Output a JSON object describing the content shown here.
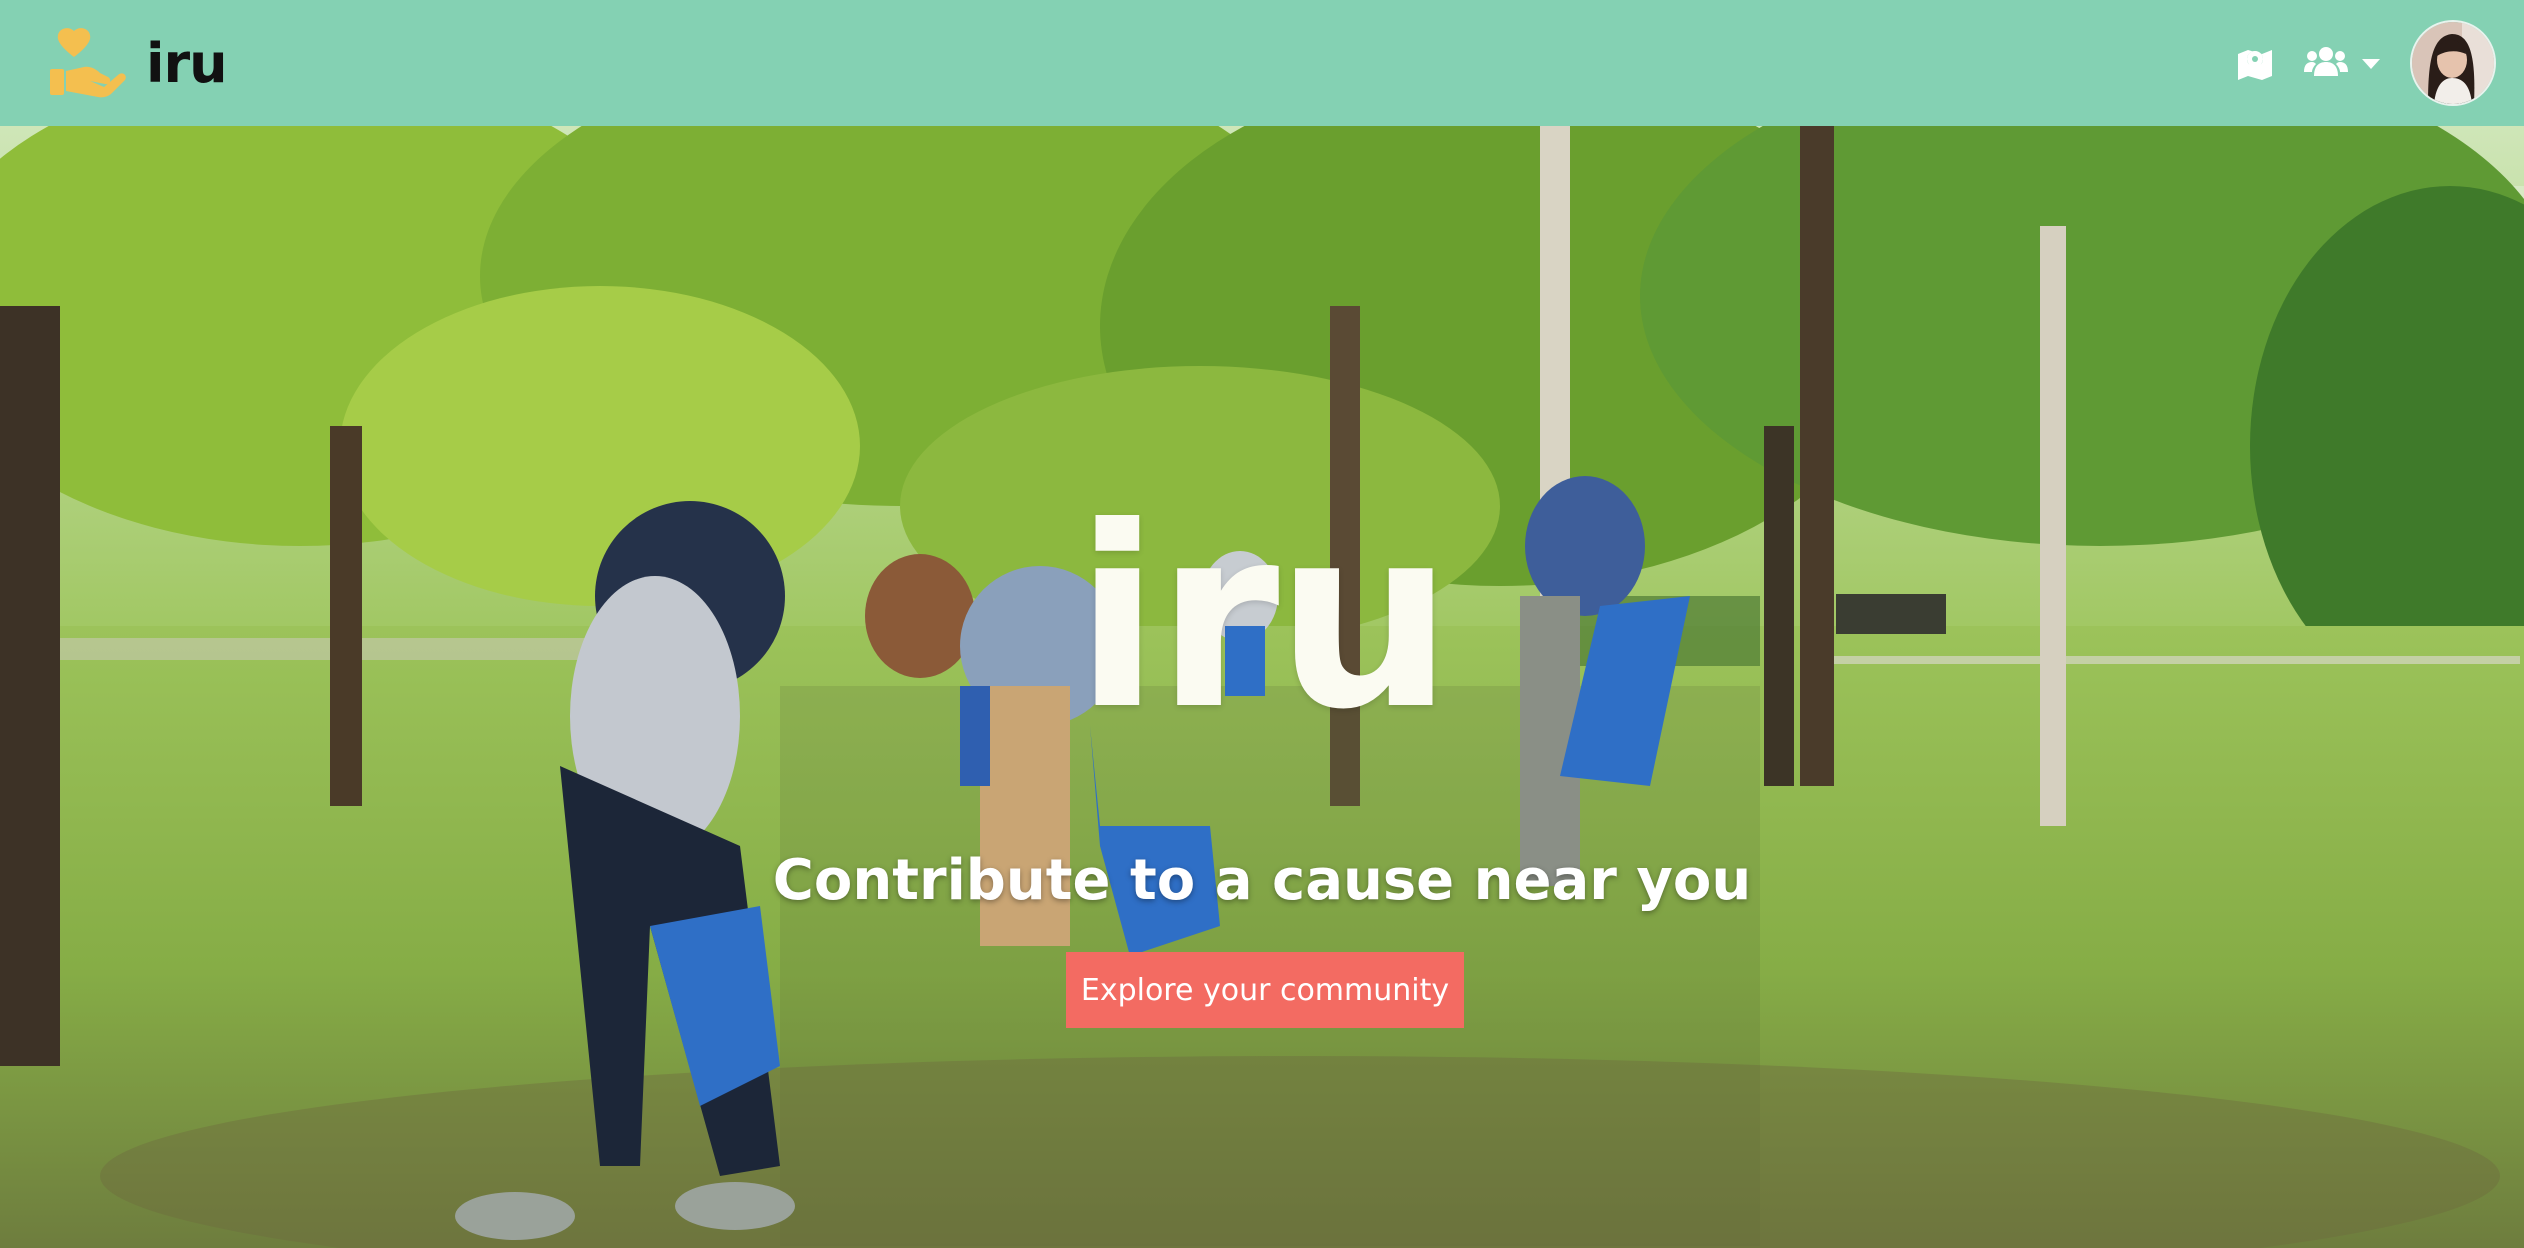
{
  "navbar": {
    "brand_name": "iru",
    "background": "#84d1b3",
    "logo_icon": "hand-holding-heart-icon",
    "icons": [
      "map-pin-icon",
      "users-icon",
      "caret-down-icon"
    ],
    "avatar": "user-avatar"
  },
  "hero": {
    "title": "iru",
    "tagline": "Contribute to a cause near you",
    "cta_label": "Explore your community",
    "cta_color": "#f36b62",
    "background_image": "volunteers-park-cleanup-photo"
  }
}
